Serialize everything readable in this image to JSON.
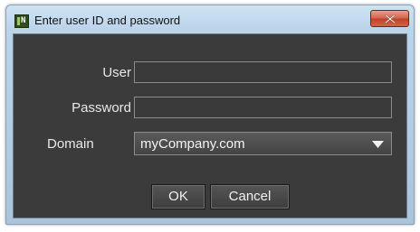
{
  "window": {
    "title": "Enter user ID and password",
    "app_icon": "app-logo-icon",
    "close_icon": "close-icon",
    "accent_close": "#c2412a",
    "client_background": "#3b3b3b"
  },
  "form": {
    "user_label": "User",
    "user_value": "",
    "password_label": "Password",
    "password_value": "",
    "domain_label": "Domain",
    "domain_value": "myCompany.com",
    "domain_dropdown_icon": "chevron-down-icon"
  },
  "buttons": {
    "ok_label": "OK",
    "cancel_label": "Cancel"
  }
}
